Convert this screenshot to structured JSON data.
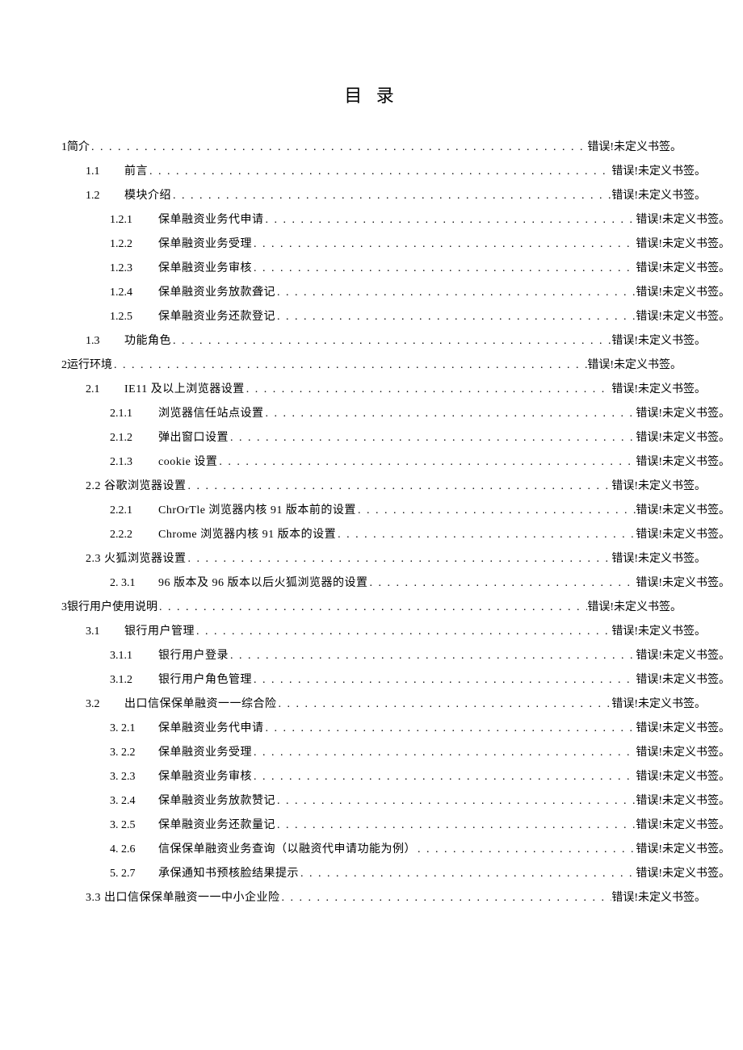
{
  "title": "目 录",
  "page_ref": "错误!未定义书签。",
  "entries": [
    {
      "indent": 0,
      "num": "1",
      "label": "简介"
    },
    {
      "indent": 1,
      "num": "1.1",
      "label": "前言"
    },
    {
      "indent": 1,
      "num": "1.2",
      "label": "模块介绍"
    },
    {
      "indent": 2,
      "num": "1.2.1",
      "label": "保单融资业务代申请"
    },
    {
      "indent": 2,
      "num": "1.2.2",
      "label": "保单融资业务受理"
    },
    {
      "indent": 2,
      "num": "1.2.3",
      "label": "保单融资业务审核"
    },
    {
      "indent": 2,
      "num": "1.2.4",
      "label": "保单融资业务放款聋记"
    },
    {
      "indent": 2,
      "num": "1.2.5",
      "label": "保单融资业务还款登记"
    },
    {
      "indent": 1,
      "num": "1.3",
      "label": "功能角色"
    },
    {
      "indent": 0,
      "num": "2",
      "label": "运行环境"
    },
    {
      "indent": 1,
      "num": "2.1",
      "label": "IE11 及以上浏览器设置"
    },
    {
      "indent": 2,
      "num": "2.1.1",
      "label": "浏览器信任站点设置"
    },
    {
      "indent": 2,
      "num": "2.1.2",
      "label": "弹出窗口设置"
    },
    {
      "indent": 2,
      "num": "2.1.3",
      "label": "cookie 设置"
    },
    {
      "indent": "1b",
      "num": "",
      "label": "2.2 谷歌浏览器设置"
    },
    {
      "indent": 2,
      "num": "2.2.1",
      "label": "ChrOrTle 浏览器内核 91 版本前的设置"
    },
    {
      "indent": 2,
      "num": "2.2.2",
      "label": "Chrome 浏览器内核 91 版本的设置"
    },
    {
      "indent": "1b",
      "num": "",
      "label": "2.3 火狐浏览器设置"
    },
    {
      "indent": 2,
      "num": "2.  3.1",
      "label": "96 版本及 96 版本以后火狐浏览器的设置"
    },
    {
      "indent": 0,
      "num": "3",
      "label": "银行用户使用说明"
    },
    {
      "indent": 1,
      "num": "3.1",
      "label": "银行用户管理"
    },
    {
      "indent": 2,
      "num": "3.1.1",
      "label": "银行用户登录"
    },
    {
      "indent": 2,
      "num": "3.1.2",
      "label": "银行用户角色管理"
    },
    {
      "indent": 1,
      "num": "3.2",
      "label": "出口信保保单融资一一综合险"
    },
    {
      "indent": 2,
      "num": "3.  2.1",
      "label": "保单融资业务代申请"
    },
    {
      "indent": 2,
      "num": "3.  2.2",
      "label": "保单融资业务受理"
    },
    {
      "indent": 2,
      "num": "3.  2.3",
      "label": "保单融资业务审核"
    },
    {
      "indent": 2,
      "num": "3.  2.4",
      "label": "保单融资业务放款赞记"
    },
    {
      "indent": 2,
      "num": "3.  2.5",
      "label": "保单融资业务还款量记"
    },
    {
      "indent": 2,
      "num": "4.  2.6",
      "label": "信保保单融资业务查询（以融资代申请功能为例）"
    },
    {
      "indent": 2,
      "num": "5.  2.7",
      "label": "承保通知书预核脸结果提示"
    },
    {
      "indent": "1b",
      "num": "",
      "label": "3.3 出口信保保单融资一一中小企业险"
    }
  ]
}
